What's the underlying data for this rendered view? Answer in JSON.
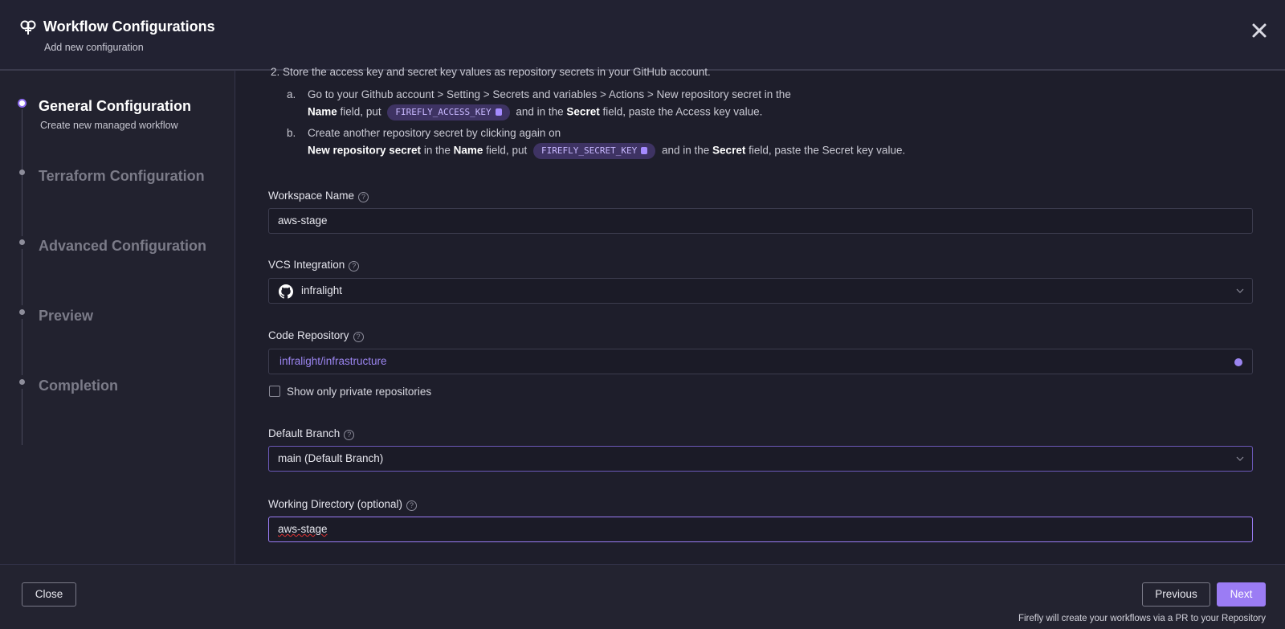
{
  "header": {
    "title": "Workflow Configurations",
    "subtitle": "Add new configuration"
  },
  "steps": [
    {
      "title": "General Configuration",
      "subtitle": "Create new managed workflow",
      "active": true
    },
    {
      "title": "Terraform Configuration"
    },
    {
      "title": "Advanced Configuration"
    },
    {
      "title": "Preview"
    },
    {
      "title": "Completion"
    }
  ],
  "instructions": {
    "step2": "2. Store the access key and secret key values as repository secrets in your GitHub account.",
    "a_marker": "a.",
    "a_line1": "Go to your Github account > Setting > Secrets and variables > Actions > New repository secret in the",
    "a_name": "Name",
    "a_field_put": "field, put",
    "a_pill": "FIREFLY_ACCESS_KEY",
    "a_and_in": "and in the",
    "a_secret": "Secret",
    "a_tail": "field, paste the Access key value.",
    "b_marker": "b.",
    "b_line1": "Create another repository secret by clicking again on",
    "b_new_repo": "New repository secret",
    "b_in_the": "in the",
    "b_name": "Name",
    "b_field_put": "field, put",
    "b_pill": "FIREFLY_SECRET_KEY",
    "b_and_in": "and in the",
    "b_secret": "Secret",
    "b_tail": "field, paste the Secret key value."
  },
  "form": {
    "workspace_label": "Workspace Name",
    "workspace_value": "aws-stage",
    "vcs_label": "VCS Integration",
    "vcs_value": "infralight",
    "repo_label": "Code Repository",
    "repo_value": "infralight/infrastructure",
    "private_only_label": "Show only private repositories",
    "private_only_checked": false,
    "branch_label": "Default Branch",
    "branch_value": "main (Default Branch)",
    "workdir_label": "Working Directory (optional)",
    "workdir_value": "aws-stage"
  },
  "footer": {
    "close_label": "Close",
    "previous_label": "Previous",
    "next_label": "Next",
    "note": "Firefly will create your workflows via a PR to your Repository"
  },
  "colors": {
    "accent": "#9b7cf4",
    "background": "#1f1f2c",
    "pill_bg": "#3e3363"
  },
  "icons": {
    "logo": "firefly-logo-icon",
    "close": "close-icon",
    "help": "help-circle-icon",
    "github": "github-icon",
    "chevron": "chevron-down-icon",
    "copy": "copy-icon"
  }
}
